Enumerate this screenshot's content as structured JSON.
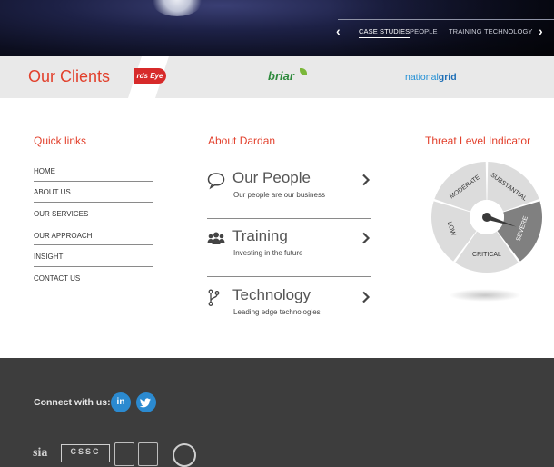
{
  "hero": {
    "carousel_tabs": [
      {
        "label": "CASE STUDIES",
        "active": true
      },
      {
        "label": "PEOPLE",
        "active": false
      },
      {
        "label": "TRAINING",
        "active": false
      },
      {
        "label": "TECHNOLOGY",
        "active": false
      }
    ],
    "prev_glyph": "‹",
    "next_glyph": "›"
  },
  "clients": {
    "title": "Our Clients",
    "logos": {
      "birds_eye": "rds Eye",
      "briar": "briar",
      "national_grid_a": "national",
      "national_grid_b": "grid"
    }
  },
  "quick_links": {
    "title": "Quick links",
    "items": [
      "HOME",
      "ABOUT US",
      "OUR SERVICES",
      "OUR APPROACH",
      "INSIGHT",
      "CONTACT US"
    ]
  },
  "about": {
    "title": "About Dardan",
    "items": [
      {
        "title": "Our People",
        "subtitle": "Our people are our business",
        "icon": "chat-bubble-icon"
      },
      {
        "title": "Training",
        "subtitle": "Investing in the future",
        "icon": "group-icon"
      },
      {
        "title": "Technology",
        "subtitle": "Leading edge technologies",
        "icon": "branch-icon"
      }
    ]
  },
  "threat": {
    "title": "Threat Level Indicator",
    "levels": [
      "LOW",
      "MODERATE",
      "SUBSTANTIAL",
      "SEVERE",
      "CRITICAL"
    ],
    "current": "SEVERE"
  },
  "footer": {
    "connect_label": "Connect with us:",
    "social": [
      {
        "name": "linkedin-icon",
        "glyph": "in"
      },
      {
        "name": "twitter-icon",
        "glyph": "t"
      }
    ],
    "accreditations": {
      "sia": "sia",
      "cssc": "CSSC"
    }
  },
  "colors": {
    "accent": "#e2402c",
    "footer_bg": "#3d3d3d",
    "gauge_active": "#808080",
    "gauge_inactive": "#dcdcdc",
    "social_blue": "#2b8ad0"
  }
}
